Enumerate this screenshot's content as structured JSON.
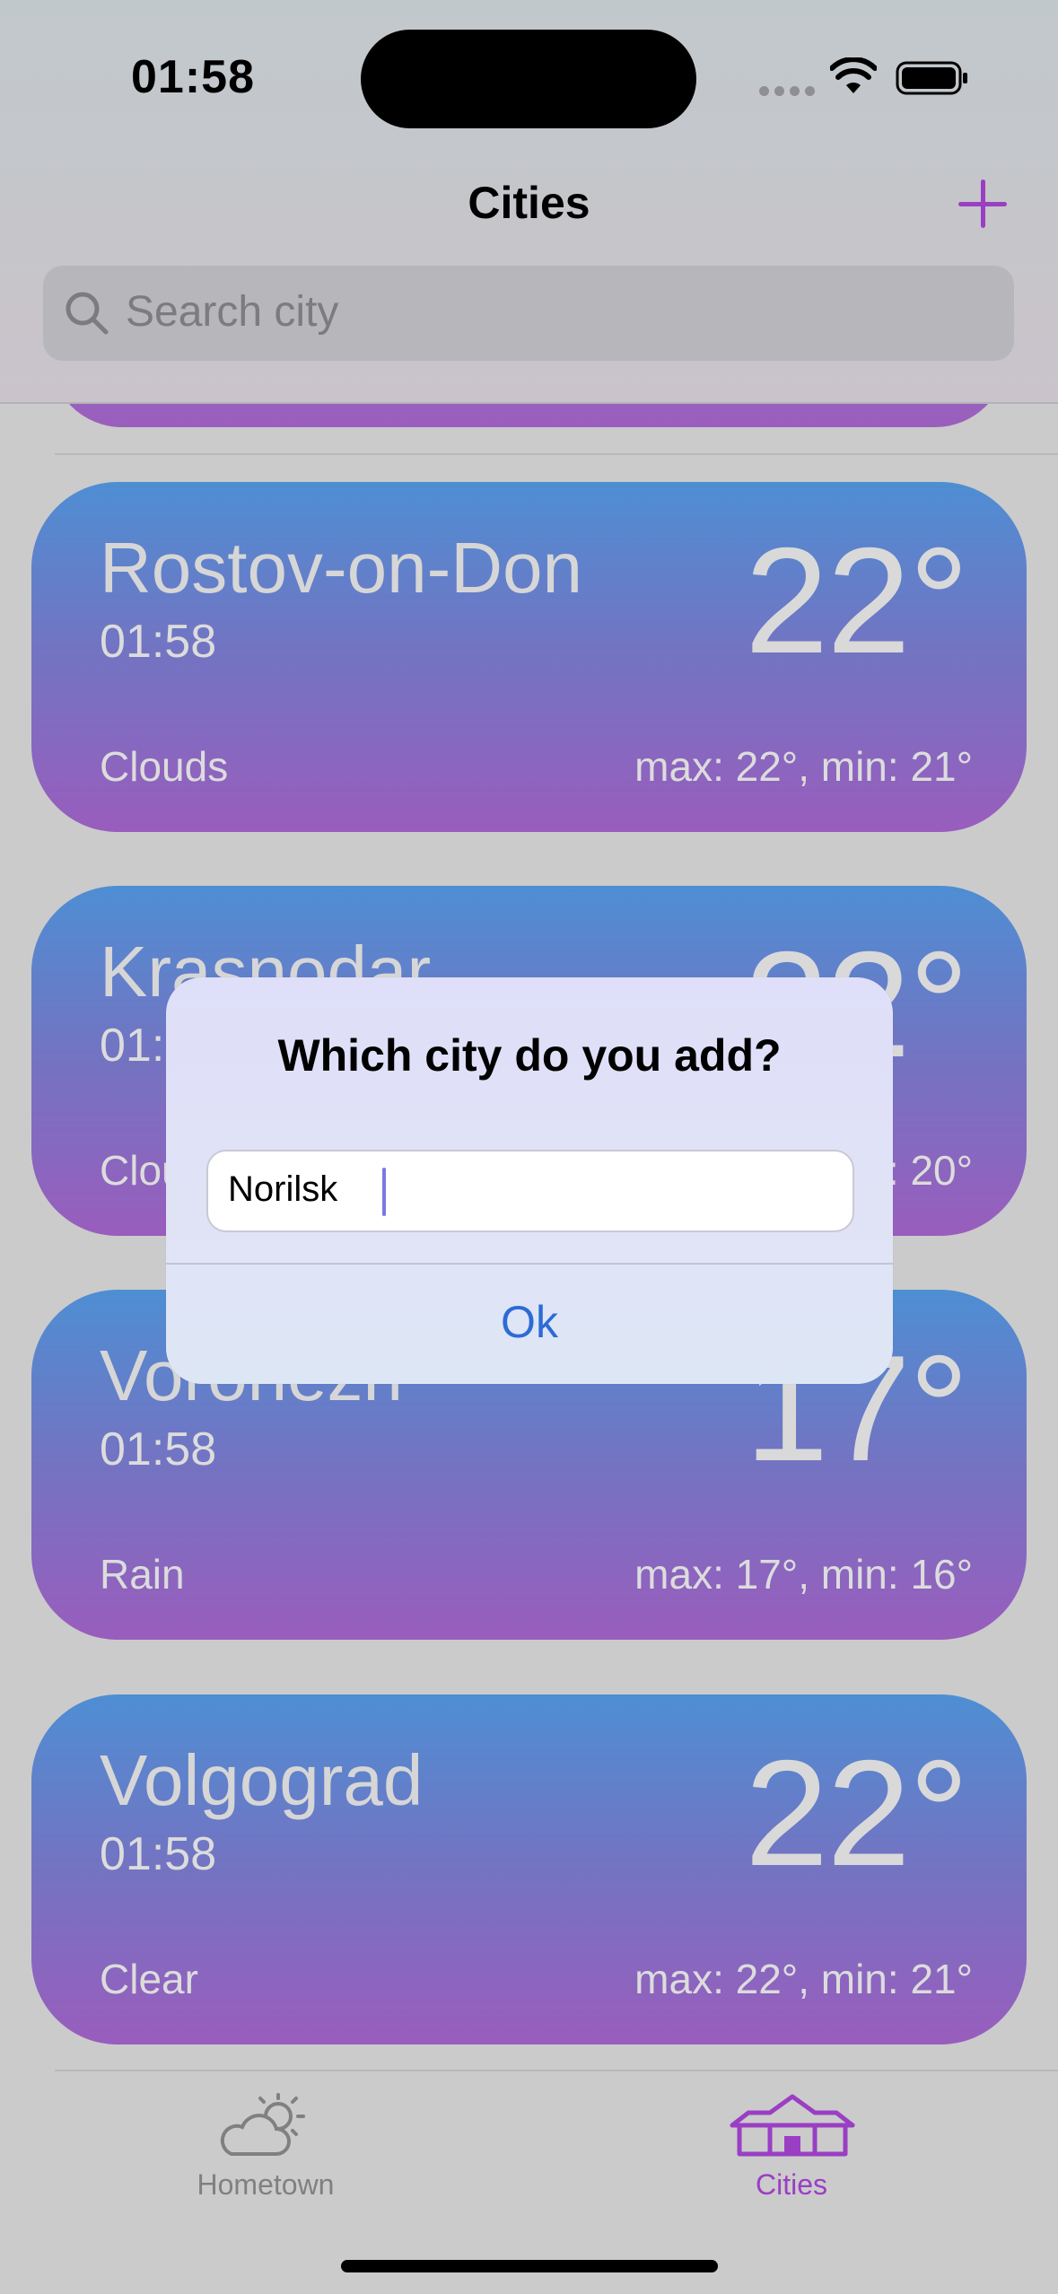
{
  "status_bar": {
    "time": "01:58"
  },
  "nav": {
    "title": "Cities",
    "add_icon": "plus-icon"
  },
  "search": {
    "placeholder": "Search city",
    "icon": "magnifier-icon"
  },
  "colors": {
    "accent": "#9a3fc4",
    "card_gradient_top": "#4e8ed3",
    "card_gradient_bottom": "#995dbd",
    "link_blue": "#2d6bd4"
  },
  "cities": [
    {
      "name": "Rostov-on-Don",
      "time": "01:58",
      "temp": "22°",
      "condition": "Clouds",
      "range": "max: 22°, min: 21°"
    },
    {
      "name": "Krasnodar",
      "time": "01:58",
      "temp": "22°",
      "condition": "Clouds",
      "range": "max: 22°, min: 20°"
    },
    {
      "name": "Voronezh",
      "time": "01:58",
      "temp": "17°",
      "condition": "Rain",
      "range": "max: 17°, min: 16°"
    },
    {
      "name": "Volgograd",
      "time": "01:58",
      "temp": "22°",
      "condition": "Clear",
      "range": "max: 22°, min: 21°"
    }
  ],
  "alert": {
    "title": "Which city do you add?",
    "input_value": "Norilsk",
    "ok_label": "Ok"
  },
  "tabbar": {
    "items": [
      {
        "label": "Hometown",
        "icon": "cloud-sun-icon",
        "selected": false
      },
      {
        "label": "Cities",
        "icon": "houses-icon",
        "selected": true
      }
    ]
  }
}
